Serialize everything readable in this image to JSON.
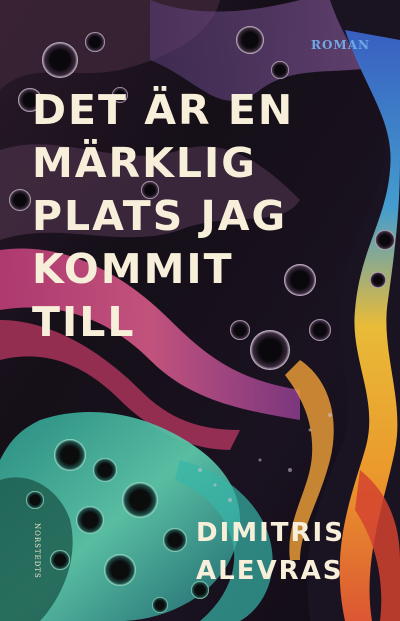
{
  "cover": {
    "genre": "ROMAN",
    "title_lines": [
      "DET ÄR EN",
      "MÄRKLIG",
      "PLATS JAG",
      "KOMMIT",
      "TILL"
    ],
    "author_lines": [
      "DIMITRIS",
      "ALEVRAS"
    ],
    "publisher": "NORSTEDTS"
  },
  "colors": {
    "title_text": "#f7efd9",
    "genre_text": "#6fa8e6",
    "background": "#120d16"
  }
}
